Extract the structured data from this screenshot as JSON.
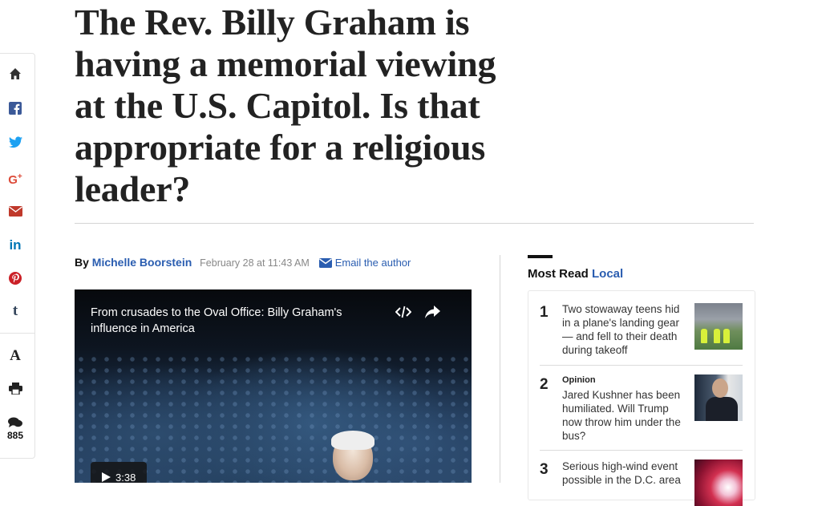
{
  "share_rail": {
    "comment_count": "885",
    "text_size_label": "A",
    "icons": [
      "home-icon",
      "facebook-icon",
      "twitter-icon",
      "google-plus-icon",
      "email-icon",
      "linkedin-icon",
      "pinterest-icon",
      "tumblr-icon",
      "text-size-icon",
      "print-icon",
      "comments-icon"
    ],
    "colors": {
      "home": "#333333",
      "facebook": "#3b5998",
      "twitter": "#1da1f2",
      "google_plus": "#dd4b39",
      "email": "#c0392b",
      "linkedin": "#0077b5",
      "pinterest": "#cb2027",
      "tumblr": "#35465c"
    }
  },
  "article": {
    "headline": "The Rev. Billy Graham is having a memorial viewing at the U.S. Capitol. Is that appropriate for a religious leader?",
    "byline": {
      "prefix": "By",
      "author": "Michelle Boorstein",
      "date": "February 28 at 11:43 AM",
      "email_label": "Email the author"
    },
    "video": {
      "title": "From crusades to the Oval Office: Billy Graham's influence in America",
      "duration": "3:38"
    }
  },
  "most_read": {
    "heading": "Most Read",
    "section": "Local",
    "items": [
      {
        "rank": "1",
        "kicker": "",
        "title": "Two stowaway teens hid in a plane's landing gear — and fell to their death during takeoff"
      },
      {
        "rank": "2",
        "kicker": "Opinion",
        "title": "Jared Kushner has been humiliated. Will Trump now throw him under the bus?"
      },
      {
        "rank": "3",
        "kicker": "",
        "title": "Serious high-wind event possible in the D.C. area"
      }
    ]
  },
  "accent_color": "#2a5db0"
}
